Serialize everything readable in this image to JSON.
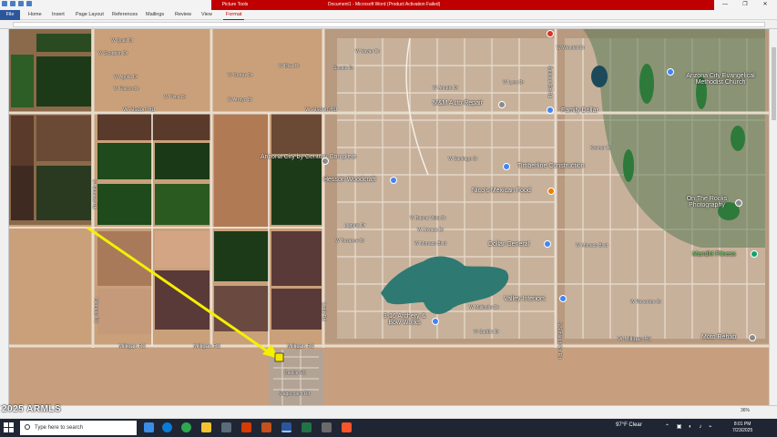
{
  "window": {
    "title": "Document1 - Microsoft Word (Product Activation Failed)",
    "context_tab": "Picture Tools",
    "controls": [
      "—",
      "❐",
      "✕"
    ]
  },
  "ribbon": {
    "tabs": [
      "File",
      "Home",
      "Insert",
      "Page Layout",
      "References",
      "Mailings",
      "Review",
      "View",
      "Format"
    ]
  },
  "map": {
    "streets": [
      "W Quail Dr",
      "W Scorpion Dr",
      "W Aguila Dr",
      "W Falcon Dr",
      "W Pima Dr",
      "W Arroyo Dr",
      "W Xavier Dr",
      "W Diaz Dr",
      "W Cortez Dr",
      "W Amado Dr",
      "W Alsdorf Rd",
      "W Alsdorf Rd",
      "W Lynx Dr",
      "W Wendell Dr",
      "W Santiago Dr",
      "W Buena Vista Dr",
      "W Arivaca Dr",
      "W Monaco Blvd",
      "W Torrance Dr",
      "W Monaco Blvd",
      "W Reventon Dr",
      "W Milligan Rd",
      "Milligan Rd",
      "Milligan Rd",
      "Milligan Rd",
      "Cuellar Rd",
      "Stagecoach Rd",
      "S Henness Rd",
      "Henness Rd",
      "Laguna Dr",
      "Lamb Rd",
      "S Sunland Gin Rd",
      "Kramer Dr",
      "W Saddle Dr",
      "Sacate Dr",
      "W Malinche Dr",
      "Sunland Gin Rd"
    ],
    "places": {
      "arizona_city": "Arizona City by Century Complete",
      "mm_auto": "M&M Auto Repair",
      "family_dollar": "Family Dollar",
      "church": "Arizona City Evangelical Methodist Church",
      "hesson": "Hesson Woodcraft",
      "timberline": "Timberline Construction",
      "nicos": "Nico's Mexican Food",
      "on_the_rocks": "On The Rocks Photography",
      "dollar_general": "Dollar General",
      "mandm_fitness": "MandM Fitness",
      "valley_interiors": "Valley Interiors",
      "archery": "3-16 Archery & Bow Works",
      "moto_rehab": "Moto Rehab"
    },
    "pin_icon": "map-pin-icon",
    "arrow_icon": "yellow-arrow-icon"
  },
  "status": {
    "zoom": "36%"
  },
  "watermark": "2025 ARMLS",
  "taskbar": {
    "search_placeholder": "Type here to search",
    "weather": "97°F  Clear",
    "time": "8:01 PM",
    "date": "7/23/2025"
  },
  "colors": {
    "title_red": "#c00000",
    "file_blue": "#2b579a",
    "desert": "#c9a07a",
    "field_green": "#1f4a1b",
    "arrow_yellow": "#f5f000",
    "water": "#2e7a73"
  }
}
